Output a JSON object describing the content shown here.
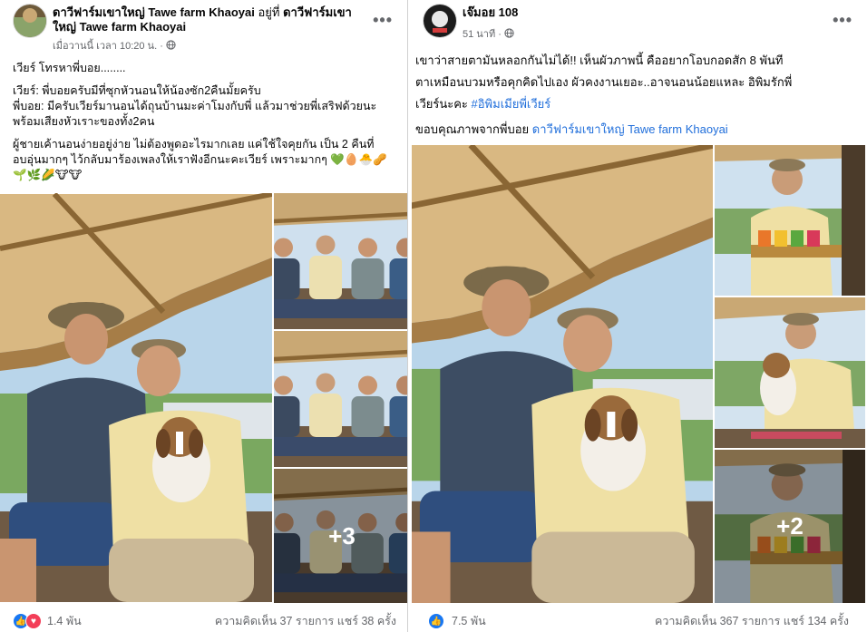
{
  "post1": {
    "author": "ดาวีฟาร์มเขาใหญ่ Tawe farm Khaoyai",
    "at": "อยู่ที่",
    "place_line1": "ดาวีฟาร์มเขา",
    "place_line2": "ใหญ่ Tawe farm Khaoyai",
    "time": "เมื่อวานนี้ เวลา 10:20 น.",
    "text": [
      "เวียร์ โทรหาพี่บอย........",
      "",
      "เวียร์: พี่บอยครับมีที่ซุกหัวนอนให้น้องซัก2คืนมั้ยครับ",
      "พี่บอย: มีครับเวียร์มานอนได้ถุนบ้านมะค่าโมงกับพี่ แล้วมาช่วยพี่เสริฟด้วยนะ",
      "พร้อมเสียงหัวเราะของทั้ง2คน",
      "",
      "ผู้ชายเค้านอนง่ายอยู่ง่าย ไม่ต้องพูดอะไรมากเลย แค่ใช้ใจคุยกัน  เป็น 2 คืนที่",
      "อบอุ่นมากๆ ไว้กลับมาร้องเพลงให้เราฟังอีกนะคะเวียร์ เพราะมากๆ 💚🥚🐣🥜",
      "🌱🌿🌽🐮🐮"
    ],
    "more_count": "+3",
    "reactions": "1.4 พัน",
    "stats": "ความคิดเห็น 37 รายการ  แชร์ 38 ครั้ง"
  },
  "post2": {
    "author": "เจ๊มอย 108",
    "time": "51 นาที",
    "text_line1": "เขาว่าสายตามันหลอกกันไม่ได้!! เห็นผัวภาพนี้ คืออยากโอบกอดสัก 8 พันที",
    "text_line2": "ตาเหมือนบวมหรือคุกคิดไปเอง ผัวคงงานเยอะ..อาจนอนน้อยแหละ อิพิมรักพี่",
    "text_line3a": "เวียร์นะคะ ",
    "hashtag": "#อิพิมเมียพี่เวียร์",
    "credit_prefix": "ขอบคุณภาพจากพี่บอย ",
    "credit_link": "ดาวีฟาร์มเขาใหญ่ Tawe farm Khaoyai",
    "more_count": "+2",
    "reactions": "7.5 พัน",
    "stats": "ความคิดเห็น 367 รายการ  แชร์ 134 ครั้ง"
  },
  "colors": {
    "like": "#1877f2",
    "love": "#f33e58",
    "link": "#216fdb",
    "meta": "#65676b"
  },
  "icons": [
    "more-options-icon",
    "globe-icon",
    "like-reaction-icon",
    "love-reaction-icon"
  ]
}
